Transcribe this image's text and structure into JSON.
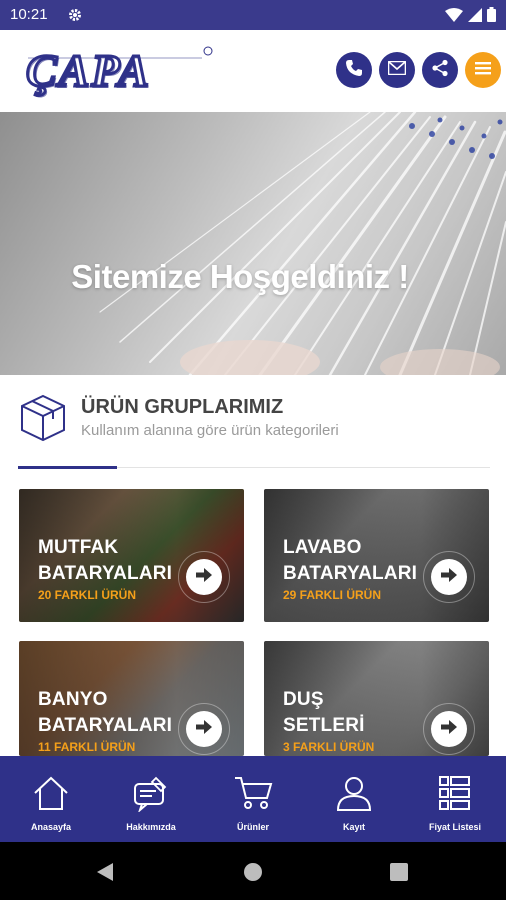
{
  "status_bar": {
    "time": "10:21"
  },
  "header": {
    "logo_text": "ÇAPA",
    "buttons": [
      {
        "icon": "phone-icon"
      },
      {
        "icon": "mail-icon"
      },
      {
        "icon": "share-icon"
      },
      {
        "icon": "menu-icon"
      }
    ],
    "colors": {
      "primary": "#2f3189",
      "accent": "#f5a01a"
    }
  },
  "hero": {
    "title": "Sitemize Hoşgeldiniz !"
  },
  "section": {
    "title": "ÜRÜN GRUPLARIMIZ",
    "subtitle": "Kullanım alanına göre ürün kategorileri"
  },
  "cards": [
    {
      "line1": "MUTFAK",
      "line2": "BATARYALARI",
      "count": "20 FARKLI ÜRÜN"
    },
    {
      "line1": "LAVABO",
      "line2": "BATARYALARI",
      "count": "29 FARKLI ÜRÜN"
    },
    {
      "line1": "BANYO",
      "line2": "BATARYALARI",
      "count": "11 FARKLI ÜRÜN"
    },
    {
      "line1": "DUŞ",
      "line2": "SETLERİ",
      "count": "3 FARKLI ÜRÜN"
    }
  ],
  "bottom_nav": [
    {
      "label": "Anasayfa",
      "icon": "home-icon"
    },
    {
      "label": "Hakkımızda",
      "icon": "about-icon"
    },
    {
      "label": "Ürünler",
      "icon": "cart-icon"
    },
    {
      "label": "Kayıt",
      "icon": "user-icon"
    },
    {
      "label": "Fiyat Listesi",
      "icon": "list-icon"
    }
  ]
}
